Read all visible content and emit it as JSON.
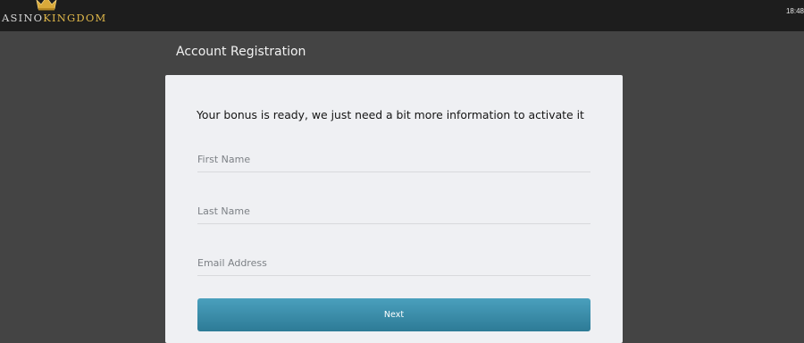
{
  "brand": {
    "casino_text": "ASINO",
    "kingdom_text": "KINGDOM",
    "crown_icon": "crown-icon",
    "colors": {
      "casino": "#d6d6d6",
      "kingdom": "#e0b84a"
    }
  },
  "clock": "18:48",
  "page": {
    "title": "Account Registration"
  },
  "form": {
    "heading": "Your bonus is ready, we just need a bit more information to activate it",
    "fields": [
      {
        "name": "first-name",
        "placeholder": "First Name",
        "value": ""
      },
      {
        "name": "last-name",
        "placeholder": "Last Name",
        "value": ""
      },
      {
        "name": "email-address",
        "placeholder": "Email Address",
        "value": ""
      }
    ],
    "next_label": "Next",
    "accent": "#3b8eab"
  }
}
